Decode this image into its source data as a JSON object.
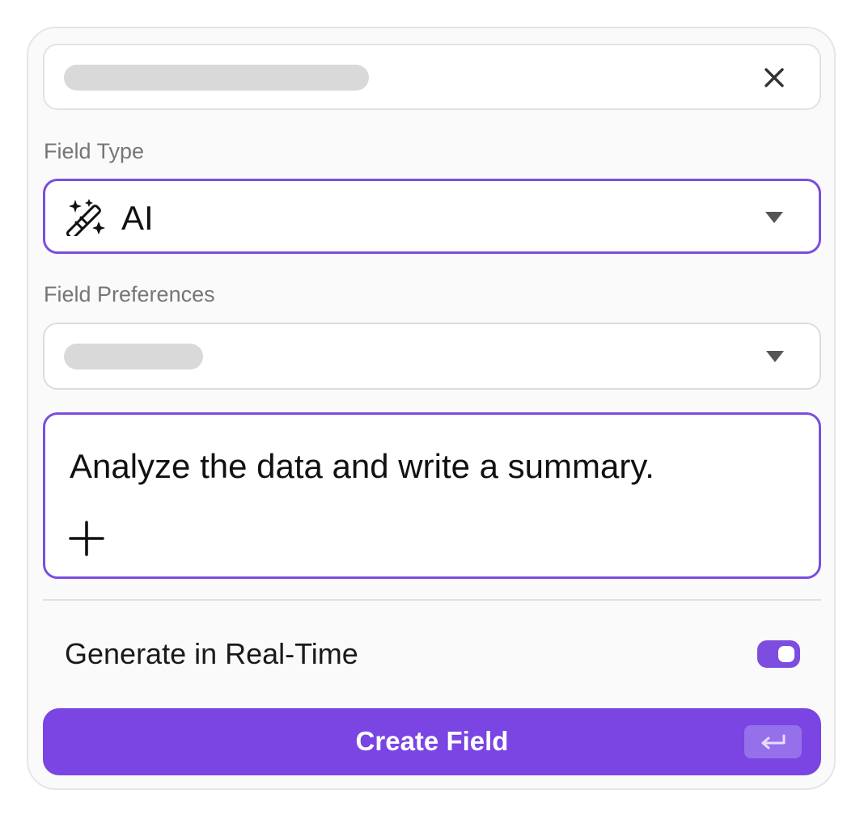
{
  "colors": {
    "accent": "#7c4ddf",
    "button": "#7a45e3",
    "skeleton": "#d9d9d9"
  },
  "name_row": {
    "close_icon": "close-icon"
  },
  "field_type": {
    "label": "Field Type",
    "value": "AI",
    "icon": "magic-wand-icon"
  },
  "field_preferences": {
    "label": "Field Preferences"
  },
  "prompt": {
    "text": "Analyze the data and write a summary.",
    "add_icon": "plus-icon"
  },
  "realtime": {
    "label": "Generate in Real-Time",
    "enabled": true
  },
  "submit": {
    "label": "Create Field",
    "shortcut_icon": "enter-key-icon"
  }
}
